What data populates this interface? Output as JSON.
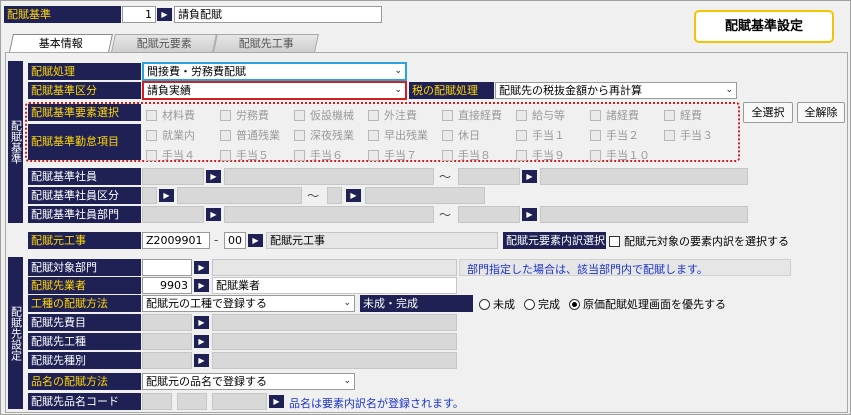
{
  "top": {
    "label": "配賦基準",
    "code": "1",
    "name": "請負配賦",
    "title": "配賦基準設定"
  },
  "tabs": [
    "基本情報",
    "配賦元要素",
    "配賦先工事"
  ],
  "basic": {
    "section_label": "配賦基準",
    "processing": {
      "label": "配賦処理",
      "value": "間接費・労務費配賦"
    },
    "category": {
      "label": "配賦基準区分",
      "value": "請負実績"
    },
    "tax": {
      "label": "税の配賦処理",
      "value": "配賦先の税抜金額から再計算"
    },
    "elements": {
      "label": "配賦基準要素選択",
      "items": [
        "材料費",
        "労務費",
        "仮設機械",
        "外注費",
        "直接経費",
        "給与等",
        "諸経費",
        "経費"
      ]
    },
    "attendance": {
      "label": "配賦基準勤怠項目",
      "row1": [
        "就業内",
        "普通残業",
        "深夜残業",
        "早出残業",
        "休日",
        "手当１",
        "手当２",
        "手当３"
      ],
      "row2": [
        "手当４",
        "手当５",
        "手当６",
        "手当７",
        "手当８",
        "手当９",
        "手当１０"
      ]
    },
    "select_all": "全選択",
    "clear_all": "全解除",
    "employee": {
      "label": "配賦基準社員",
      "tilde": "～"
    },
    "employee_class": {
      "label": "配賦基準社員区分",
      "tilde": "～"
    },
    "employee_dept": {
      "label": "配賦基準社員部門",
      "tilde": "～"
    }
  },
  "source": {
    "label": "配賦元工事",
    "code": "Z2009901",
    "dash": "-",
    "sub": "00",
    "name": "配賦元工事",
    "detail_label": "配賦元要素内訳選択",
    "detail_check": "配賦元対象の要素内訳を選択する"
  },
  "dest": {
    "section_label": "配賦先設定",
    "target_dept": {
      "label": "配賦対象部門",
      "note": "部門指定した場合は、該当部門内で配賦します。"
    },
    "vendor": {
      "label": "配賦先業者",
      "code": "9903",
      "name": "配賦業者"
    },
    "method": {
      "label": "工種の配賦方法",
      "value": "配賦元の工種で登録する"
    },
    "status": {
      "label": "未成・完成",
      "options": [
        "未成",
        "完成",
        "原価配賦処理画面を優先する"
      ],
      "selected": 2
    },
    "expense": {
      "label": "配賦先費目"
    },
    "work": {
      "label": "配賦先工種"
    },
    "kind": {
      "label": "配賦先種別"
    },
    "item_method": {
      "label": "品名の配賦方法",
      "value": "配賦元の品名で登録する"
    },
    "item_code": {
      "label": "配賦先品名コード",
      "note": "品名は要素内訳名が登録されます。"
    }
  }
}
